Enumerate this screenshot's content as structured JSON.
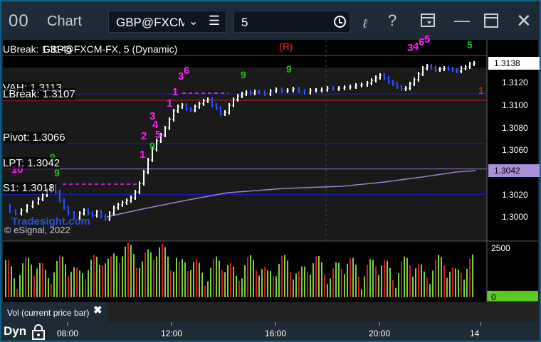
{
  "window": {
    "logo": "00",
    "title": "Chart",
    "symbol": "GBP@FXCM",
    "interval": "5"
  },
  "chart": {
    "info_text": "UBreak: 1.3145",
    "info_text2": "GBP@FXCM-FX, 5 (Dynamic)",
    "r_label": "(R)",
    "right_one": "1",
    "watermark": "© eSignal, 2022",
    "brand": "Tradesight.com",
    "levels": [
      {
        "label": "VAH: 1.3113",
        "price": 1.3113,
        "color": "#2020c0"
      },
      {
        "label": "LBreak: 1.3107",
        "price": 1.3107,
        "color": "#cc2020"
      },
      {
        "label": "Pivot: 1.3066",
        "price": 1.3066,
        "color": "#2020c0"
      },
      {
        "label": "LPT: 1.3042",
        "price": 1.3042,
        "color": "#a080d0"
      },
      {
        "label": "S1: 1.3018",
        "price": 1.3018,
        "color": "#2020c0"
      }
    ],
    "price_axis": [
      "1.3120",
      "1.3100",
      "1.3080",
      "1.3060",
      "1.3020",
      "1.3000"
    ],
    "price_tags": [
      {
        "text": "1.3138",
        "bg": "#ffffff",
        "fg": "#000000"
      },
      {
        "text": "1.3042",
        "bg": "#a890d8",
        "fg": "#000000"
      }
    ],
    "volume_axis": [
      "2500",
      "0"
    ],
    "volume_legend": "Vol (current price bar)",
    "time_axis": [
      "08:00",
      "12:00",
      "16:00",
      "20:00",
      "14"
    ],
    "dyn": "Dyn",
    "markers": [
      "3",
      "4",
      "6",
      "5",
      "1",
      "1",
      "3",
      "6",
      "5",
      "4",
      "3",
      "2",
      "1",
      "10",
      "9",
      "9",
      "9",
      "9",
      "9",
      "5"
    ],
    "colors": {
      "accent_blue": "#0f5f86",
      "up_bar": "#ffffff",
      "down_bar": "#2a50ff",
      "vol_up": "#7ccf3a",
      "vol_down": "#cc2020",
      "magenta": "#ff20ff",
      "green_count": "#20c020"
    }
  }
}
